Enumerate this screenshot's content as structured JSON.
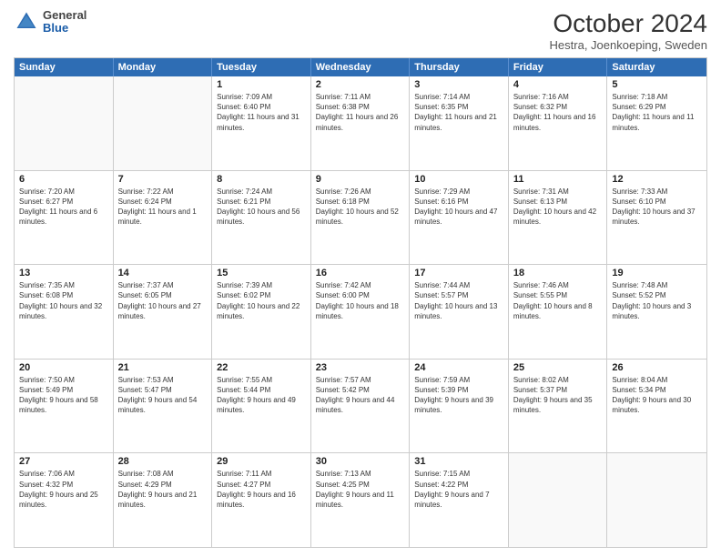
{
  "header": {
    "logo": {
      "general": "General",
      "blue": "Blue"
    },
    "title": "October 2024",
    "location": "Hestra, Joenkoeping, Sweden"
  },
  "weekdays": [
    "Sunday",
    "Monday",
    "Tuesday",
    "Wednesday",
    "Thursday",
    "Friday",
    "Saturday"
  ],
  "weeks": [
    [
      {
        "day": "",
        "info": ""
      },
      {
        "day": "",
        "info": ""
      },
      {
        "day": "1",
        "info": "Sunrise: 7:09 AM\nSunset: 6:40 PM\nDaylight: 11 hours and 31 minutes."
      },
      {
        "day": "2",
        "info": "Sunrise: 7:11 AM\nSunset: 6:38 PM\nDaylight: 11 hours and 26 minutes."
      },
      {
        "day": "3",
        "info": "Sunrise: 7:14 AM\nSunset: 6:35 PM\nDaylight: 11 hours and 21 minutes."
      },
      {
        "day": "4",
        "info": "Sunrise: 7:16 AM\nSunset: 6:32 PM\nDaylight: 11 hours and 16 minutes."
      },
      {
        "day": "5",
        "info": "Sunrise: 7:18 AM\nSunset: 6:29 PM\nDaylight: 11 hours and 11 minutes."
      }
    ],
    [
      {
        "day": "6",
        "info": "Sunrise: 7:20 AM\nSunset: 6:27 PM\nDaylight: 11 hours and 6 minutes."
      },
      {
        "day": "7",
        "info": "Sunrise: 7:22 AM\nSunset: 6:24 PM\nDaylight: 11 hours and 1 minute."
      },
      {
        "day": "8",
        "info": "Sunrise: 7:24 AM\nSunset: 6:21 PM\nDaylight: 10 hours and 56 minutes."
      },
      {
        "day": "9",
        "info": "Sunrise: 7:26 AM\nSunset: 6:18 PM\nDaylight: 10 hours and 52 minutes."
      },
      {
        "day": "10",
        "info": "Sunrise: 7:29 AM\nSunset: 6:16 PM\nDaylight: 10 hours and 47 minutes."
      },
      {
        "day": "11",
        "info": "Sunrise: 7:31 AM\nSunset: 6:13 PM\nDaylight: 10 hours and 42 minutes."
      },
      {
        "day": "12",
        "info": "Sunrise: 7:33 AM\nSunset: 6:10 PM\nDaylight: 10 hours and 37 minutes."
      }
    ],
    [
      {
        "day": "13",
        "info": "Sunrise: 7:35 AM\nSunset: 6:08 PM\nDaylight: 10 hours and 32 minutes."
      },
      {
        "day": "14",
        "info": "Sunrise: 7:37 AM\nSunset: 6:05 PM\nDaylight: 10 hours and 27 minutes."
      },
      {
        "day": "15",
        "info": "Sunrise: 7:39 AM\nSunset: 6:02 PM\nDaylight: 10 hours and 22 minutes."
      },
      {
        "day": "16",
        "info": "Sunrise: 7:42 AM\nSunset: 6:00 PM\nDaylight: 10 hours and 18 minutes."
      },
      {
        "day": "17",
        "info": "Sunrise: 7:44 AM\nSunset: 5:57 PM\nDaylight: 10 hours and 13 minutes."
      },
      {
        "day": "18",
        "info": "Sunrise: 7:46 AM\nSunset: 5:55 PM\nDaylight: 10 hours and 8 minutes."
      },
      {
        "day": "19",
        "info": "Sunrise: 7:48 AM\nSunset: 5:52 PM\nDaylight: 10 hours and 3 minutes."
      }
    ],
    [
      {
        "day": "20",
        "info": "Sunrise: 7:50 AM\nSunset: 5:49 PM\nDaylight: 9 hours and 58 minutes."
      },
      {
        "day": "21",
        "info": "Sunrise: 7:53 AM\nSunset: 5:47 PM\nDaylight: 9 hours and 54 minutes."
      },
      {
        "day": "22",
        "info": "Sunrise: 7:55 AM\nSunset: 5:44 PM\nDaylight: 9 hours and 49 minutes."
      },
      {
        "day": "23",
        "info": "Sunrise: 7:57 AM\nSunset: 5:42 PM\nDaylight: 9 hours and 44 minutes."
      },
      {
        "day": "24",
        "info": "Sunrise: 7:59 AM\nSunset: 5:39 PM\nDaylight: 9 hours and 39 minutes."
      },
      {
        "day": "25",
        "info": "Sunrise: 8:02 AM\nSunset: 5:37 PM\nDaylight: 9 hours and 35 minutes."
      },
      {
        "day": "26",
        "info": "Sunrise: 8:04 AM\nSunset: 5:34 PM\nDaylight: 9 hours and 30 minutes."
      }
    ],
    [
      {
        "day": "27",
        "info": "Sunrise: 7:06 AM\nSunset: 4:32 PM\nDaylight: 9 hours and 25 minutes."
      },
      {
        "day": "28",
        "info": "Sunrise: 7:08 AM\nSunset: 4:29 PM\nDaylight: 9 hours and 21 minutes."
      },
      {
        "day": "29",
        "info": "Sunrise: 7:11 AM\nSunset: 4:27 PM\nDaylight: 9 hours and 16 minutes."
      },
      {
        "day": "30",
        "info": "Sunrise: 7:13 AM\nSunset: 4:25 PM\nDaylight: 9 hours and 11 minutes."
      },
      {
        "day": "31",
        "info": "Sunrise: 7:15 AM\nSunset: 4:22 PM\nDaylight: 9 hours and 7 minutes."
      },
      {
        "day": "",
        "info": ""
      },
      {
        "day": "",
        "info": ""
      }
    ]
  ]
}
